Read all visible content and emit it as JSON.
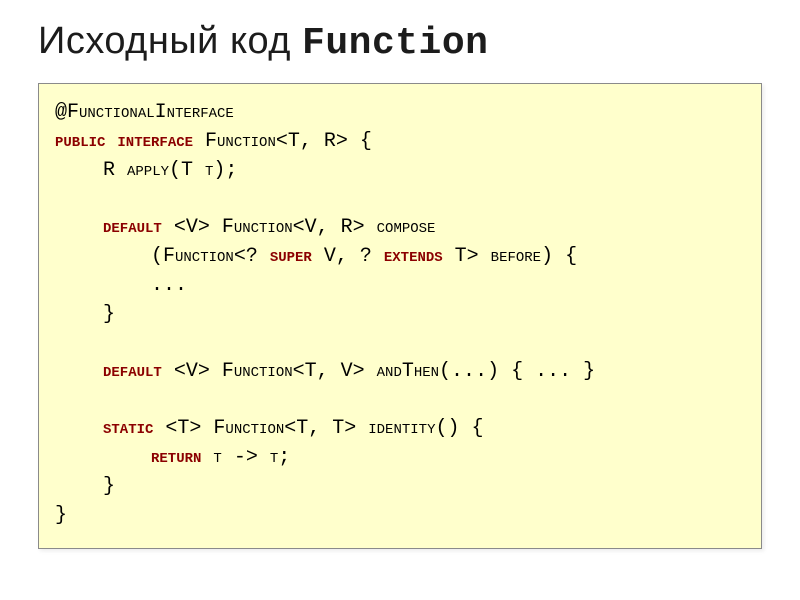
{
  "title": {
    "prefix": "Исходный код ",
    "mono": "Function"
  },
  "code": {
    "l1": "@FunctionalInterface",
    "l2_a": "public interface",
    "l2_b": " Function<T, R> {",
    "l3": "R apply(T t);",
    "l4_a": "default",
    "l4_b": " <V> Function<V, R> compose",
    "l5_a": "(Function<? ",
    "l5_b": "super",
    "l5_c": " V, ? ",
    "l5_d": "extends",
    "l5_e": " T> before) {",
    "l6": "...",
    "l7": "}",
    "l8_a": "default",
    "l8_b": " <V> Function<T, V> andThen(...) { ... }",
    "l9_a": "static",
    "l9_b": " <T> Function<T, T> identity() {",
    "l10_a": "return",
    "l10_b": " t -> t;",
    "l11": "}",
    "l12": "}"
  }
}
